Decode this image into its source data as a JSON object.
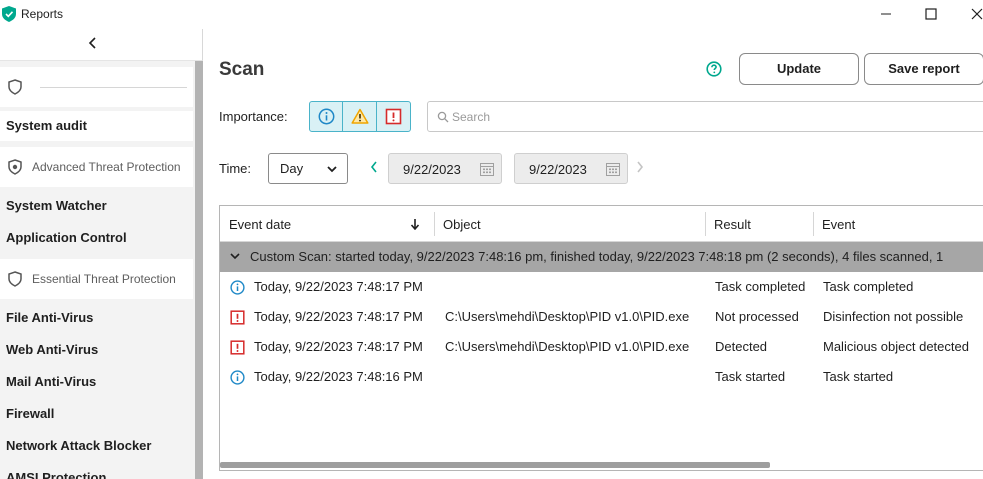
{
  "window": {
    "title": "Reports",
    "icon": "kaspersky-shield-icon",
    "controls": [
      "minimize-icon",
      "maximize-icon",
      "close-icon"
    ]
  },
  "sidebar": {
    "collapse_icon": "chevron-left-icon",
    "groups": [
      {
        "label": ""
      },
      {
        "label": "Advanced Threat Protection"
      },
      {
        "label": "Essential Threat Protection"
      }
    ],
    "items": [
      {
        "label": "System audit"
      },
      {
        "label": "System Watcher"
      },
      {
        "label": "Application Control"
      },
      {
        "label": "File Anti-Virus"
      },
      {
        "label": "Web Anti-Virus"
      },
      {
        "label": "Mail Anti-Virus"
      },
      {
        "label": "Firewall"
      },
      {
        "label": "Network Attack Blocker"
      },
      {
        "label": "AMSI Protection"
      }
    ]
  },
  "main": {
    "title": "Scan",
    "help_icon": "help-icon",
    "update_label": "Update",
    "save_report_label": "Save report",
    "importance_label": "Importance:",
    "importance_filters": [
      "info-icon",
      "warning-icon",
      "critical-icon"
    ],
    "search_placeholder": "Search",
    "time_label": "Time:",
    "time_period": "Day",
    "date_from": "9/22/2023",
    "date_to": "9/22/2023"
  },
  "table": {
    "columns": [
      "Event date",
      "Object",
      "Result",
      "Event"
    ],
    "sort_icon": "arrow-down-icon",
    "group": {
      "text": "Custom Scan: started today, 9/22/2023 7:48:16 pm, finished today, 9/22/2023 7:48:18 pm (2 seconds), 4 files scanned, 1"
    },
    "rows": [
      {
        "severity": "info",
        "date": "Today, 9/22/2023 7:48:17 PM",
        "object": "",
        "result": "Task completed",
        "event": "Task completed"
      },
      {
        "severity": "critical",
        "date": "Today, 9/22/2023 7:48:17 PM",
        "object": "C:\\Users\\mehdi\\Desktop\\PID v1.0\\PID.exe",
        "result": "Not processed",
        "event": "Disinfection not possible"
      },
      {
        "severity": "critical",
        "date": "Today, 9/22/2023 7:48:17 PM",
        "object": "C:\\Users\\mehdi\\Desktop\\PID v1.0\\PID.exe",
        "result": "Detected",
        "event": "Malicious object detected"
      },
      {
        "severity": "info",
        "date": "Today, 9/22/2023 7:48:16 PM",
        "object": "",
        "result": "Task started",
        "event": "Task started"
      }
    ]
  },
  "colors": {
    "accent": "#00a88e",
    "info": "#1e88c7",
    "warning": "#f0a500",
    "critical": "#d62b2b",
    "importance_bg": "#d9f1f5",
    "group_row_bg": "#a6a6a6"
  }
}
